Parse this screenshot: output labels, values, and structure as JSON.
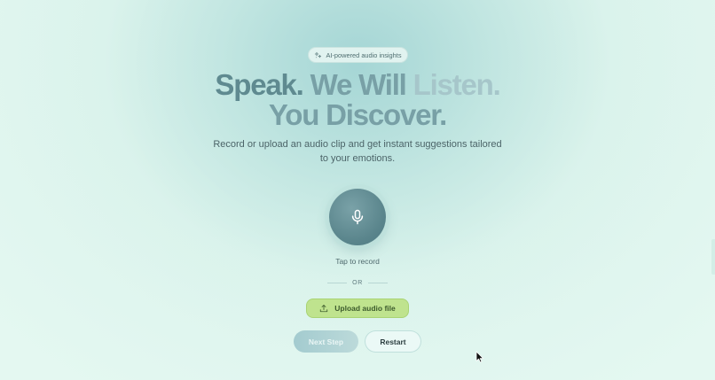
{
  "badge": {
    "icon": "sparkle-icon",
    "label": "AI-powered audio insights"
  },
  "headline": {
    "line1": {
      "part1": "Speak.",
      "part2": "We Will",
      "part3": "Listen."
    },
    "line2": {
      "part1": "You Discover."
    }
  },
  "subtitle": "Record or upload an audio clip and get instant suggestions tailored to your emotions.",
  "recorder": {
    "icon": "microphone-icon",
    "label": "Tap to record"
  },
  "divider": {
    "label": "OR"
  },
  "upload": {
    "icon": "upload-icon",
    "label": "Upload audio file"
  },
  "actions": {
    "next_label": "Next Step",
    "restart_label": "Restart"
  },
  "colors": {
    "background": "#e4f8f1",
    "accent_teal": "#5f8a90",
    "upload_green": "#bfe38e"
  }
}
